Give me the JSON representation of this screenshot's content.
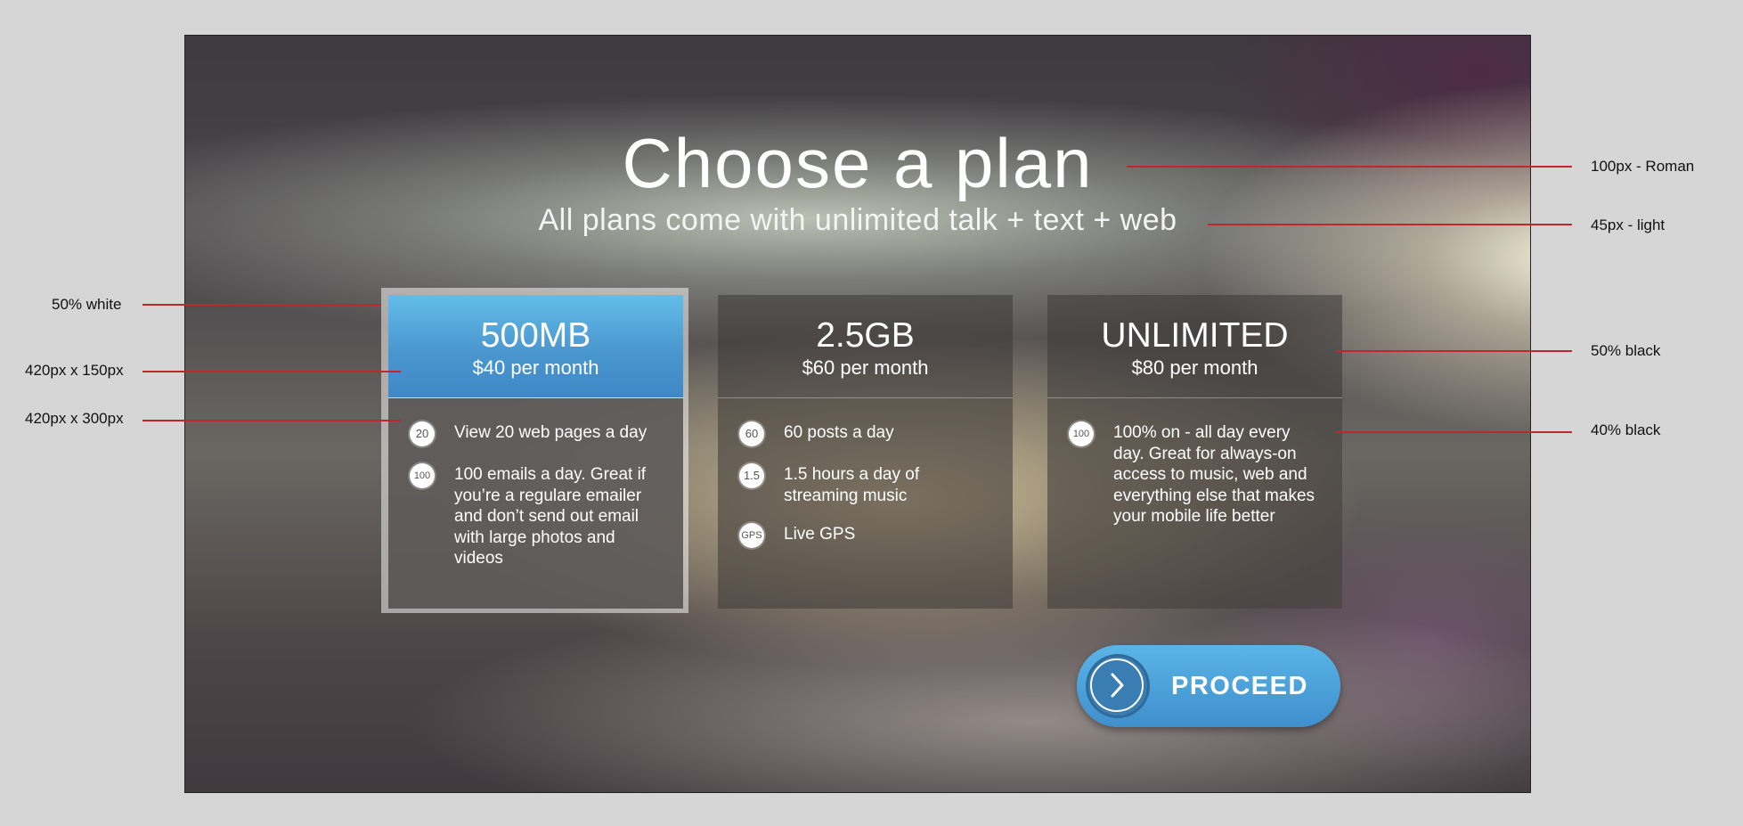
{
  "header": {
    "title": "Choose a plan",
    "subtitle": "All plans come with unlimited talk + text + web"
  },
  "plans": [
    {
      "size": "500MB",
      "price": "$40 per month",
      "selected": true,
      "features": [
        {
          "badge": "20",
          "text": "View 20 web pages a day"
        },
        {
          "badge": "100",
          "text": "100 emails a day. Great if you’re a regulare emailer and don’t send out email with large photos and videos"
        }
      ]
    },
    {
      "size": "2.5GB",
      "price": "$60 per month",
      "selected": false,
      "features": [
        {
          "badge": "60",
          "text": "60 posts a day"
        },
        {
          "badge": "1.5",
          "text": "1.5 hours a day of streaming music"
        },
        {
          "badge": "GPS",
          "text": "Live GPS"
        }
      ]
    },
    {
      "size": "UNLIMITED",
      "price": "$80 per month",
      "selected": false,
      "features": [
        {
          "badge": "100",
          "text": "100% on - all day every day. Great for always-on access to music, web and everything else that makes your mobile life better"
        }
      ]
    }
  ],
  "proceed": {
    "label": "PROCEED",
    "icon": "chevron-right-icon"
  },
  "annotations": {
    "title_spec": "100px - Roman",
    "subtitle_spec": "45px - light",
    "highlight_spec": "50% white",
    "header_size_spec": "420px x 150px",
    "body_size_spec": "420px x 300px",
    "header_fill_spec": "50% black",
    "body_fill_spec": "40% black"
  },
  "colors": {
    "accent_blue": "#4a97cf",
    "annotation_line": "#c0272d",
    "canvas_bg": "#d6d6d6"
  }
}
